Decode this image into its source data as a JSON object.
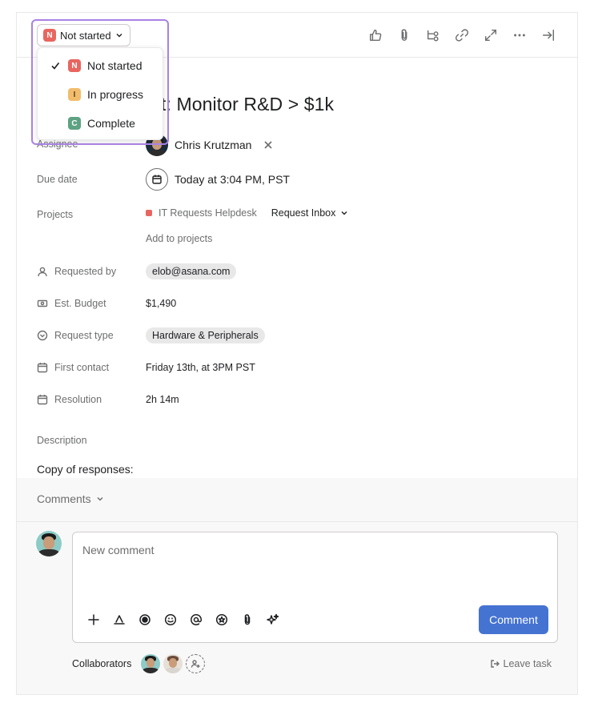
{
  "header": {
    "status_label": "Not started",
    "status_letter": "N",
    "toolbar": [
      {
        "name": "like-icon"
      },
      {
        "name": "attachment-icon"
      },
      {
        "name": "subtask-icon"
      },
      {
        "name": "link-icon"
      },
      {
        "name": "expand-icon"
      },
      {
        "name": "more-icon"
      },
      {
        "name": "close-panel-icon"
      }
    ]
  },
  "task": {
    "title_visible": "t: Monitor R&D > $1k"
  },
  "fields": {
    "assignee": {
      "label": "Assignee",
      "value": "Chris Krutzman"
    },
    "due_date": {
      "label": "Due date",
      "value": "Today at 3:04 PM, PST"
    },
    "projects": {
      "label": "Projects",
      "project": "IT Requests Helpdesk",
      "section": "Request Inbox",
      "add": "Add to projects"
    },
    "requested_by": {
      "label": "Requested by",
      "value": "elob@asana.com"
    },
    "budget": {
      "label": "Est. Budget",
      "value": "$1,490"
    },
    "request_type": {
      "label": "Request type",
      "value": "Hardware & Peripherals"
    },
    "first_contact": {
      "label": "First contact",
      "value": "Friday 13th, at 3PM PST"
    },
    "resolution": {
      "label": "Resolution",
      "value": "2h 14m"
    }
  },
  "description": {
    "label": "Description",
    "text": "Copy of responses:"
  },
  "comments": {
    "toggle_label": "Comments",
    "placeholder": "New comment",
    "submit_label": "Comment",
    "collaborators_label": "Collaborators",
    "leave_label": "Leave task"
  },
  "status_menu": {
    "items": [
      {
        "letter": "N",
        "label": "Not started",
        "selected": true,
        "color": "#e8665f"
      },
      {
        "letter": "I",
        "label": "In progress",
        "selected": false,
        "color": "#f1bd6c"
      },
      {
        "letter": "C",
        "label": "Complete",
        "selected": false,
        "color": "#5da283"
      }
    ]
  },
  "colors": {
    "accent": "#4573d2",
    "highlight": "#a981e3"
  }
}
